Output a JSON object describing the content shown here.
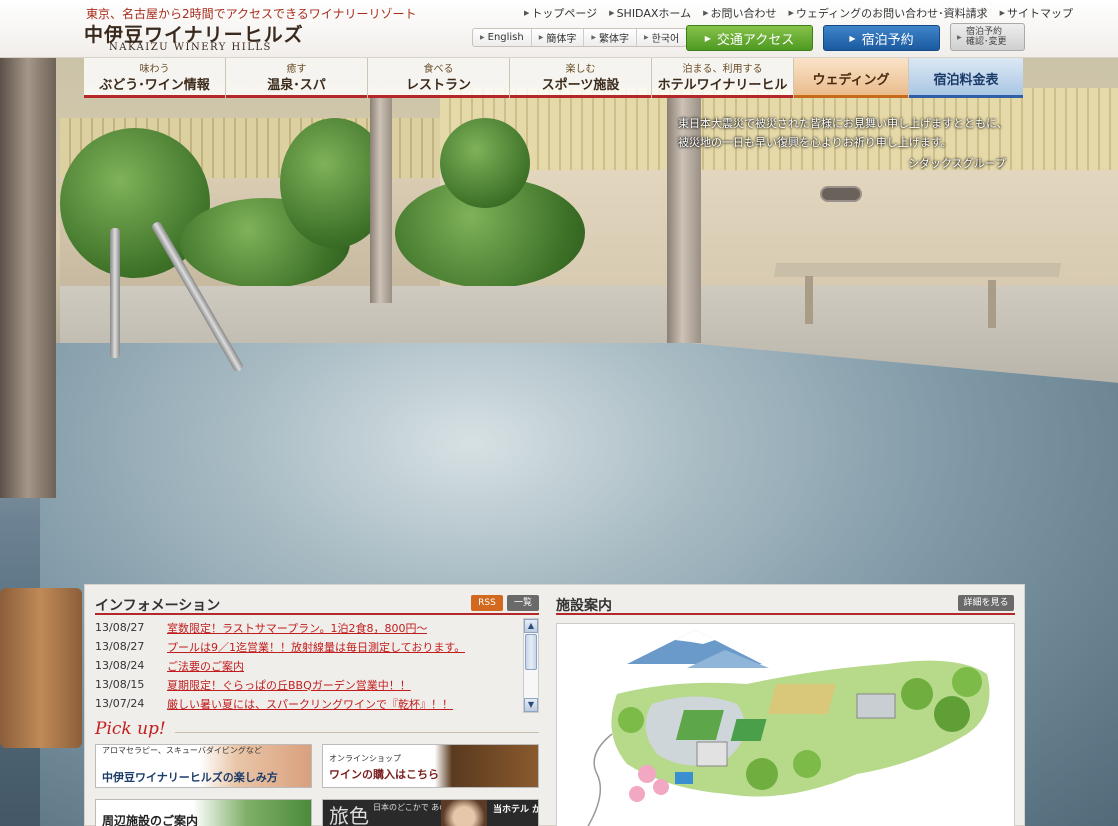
{
  "header": {
    "tagline": "東京、名古屋から2時間でアクセスできるワイナリーリゾート",
    "logo_jp": "中伊豆ワイナリーヒルズ",
    "logo_en": "NAKAIZU WINERY HILLS",
    "top_links": [
      "トップページ",
      "SHIDAXホーム",
      "お問い合わせ",
      "ウェディングのお問い合わせ･資料請求",
      "サイトマップ"
    ],
    "languages": [
      "English",
      "簡体字",
      "繁体字",
      "한국어"
    ],
    "access_button": "交通アクセス",
    "reserve_button": "宿泊予約",
    "confirm_button_line1": "宿泊予約",
    "confirm_button_line2": "確認･変更"
  },
  "nav": {
    "items": [
      {
        "sub": "味わう",
        "label": "ぶどう･ワイン情報"
      },
      {
        "sub": "癒す",
        "label": "温泉･スパ"
      },
      {
        "sub": "食べる",
        "label": "レストラン"
      },
      {
        "sub": "楽しむ",
        "label": "スポーツ施設"
      },
      {
        "sub": "泊まる、利用する",
        "label": "ホテルワイナリーヒル"
      }
    ],
    "wedding": "ウェディング",
    "price": "宿泊料金表"
  },
  "notice": {
    "line1": "東日本大震災で被災された皆様にお見舞い申し上げますとともに、",
    "line2": "被災地の一日も早い復興を心よりお祈り申し上げます。",
    "signature": "シダックスグループ"
  },
  "info": {
    "heading": "インフォメーション",
    "rss": "RSS",
    "list": "一覧",
    "news": [
      {
        "date": "13/08/27",
        "title": "室数限定！ラストサマープラン。1泊2食8，800円〜"
      },
      {
        "date": "13/08/27",
        "title": "プールは9／1迄営業！！放射線量は毎日測定しております。"
      },
      {
        "date": "13/08/24",
        "title": "ご法要のご案内"
      },
      {
        "date": "13/08/15",
        "title": "夏期限定！ぐらっぱの丘BBQガーデン営業中！！"
      },
      {
        "date": "13/07/24",
        "title": "厳しい暑い夏には、スパークリングワインで『乾杯』！！"
      }
    ]
  },
  "pickup": {
    "heading": "Pick up!",
    "banner1_small": "アロマセラピー、スキューバダイビングなど",
    "banner1_big": "中伊豆ワイナリーヒルズの楽しみ方",
    "banner2_small": "オンラインショップ",
    "banner2_big": "ワインの購入はこちら",
    "banner3_big": "周辺施設のご案内",
    "banner4_big": "旅色",
    "banner4_small": "日本のどこかで あの女優が",
    "banner4_right": "当ホテル が紹介され"
  },
  "facility": {
    "heading": "施設案内",
    "detail_button": "詳細を見る"
  },
  "colors": {
    "accent_red": "#b5282a",
    "link_red": "#c01e1e",
    "access_green": "#5aa62b",
    "reserve_blue": "#1f63ad"
  }
}
